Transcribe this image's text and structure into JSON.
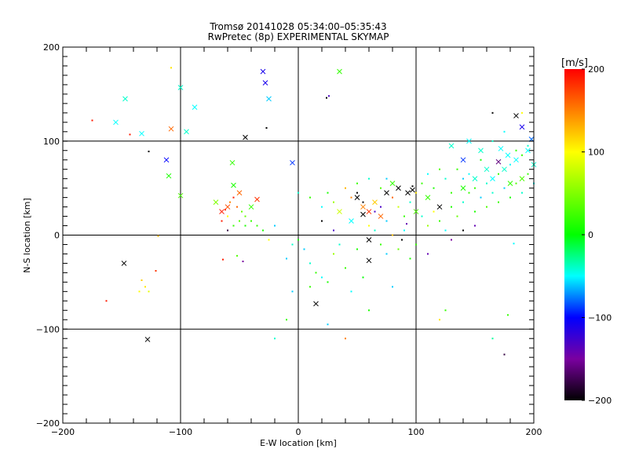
{
  "chart_data": {
    "type": "scatter",
    "title": "Tromsø 20141028 05:34:00–05:35:43",
    "subtitle": "RwPretec (8p) EXPERIMENTAL SKYMAP",
    "xlabel": "E-W location [km]",
    "ylabel": "N-S location [km]",
    "xlim": [
      -200,
      200
    ],
    "ylim": [
      -200,
      200
    ],
    "xticks": [
      -200,
      -100,
      0,
      100,
      200
    ],
    "yticks": [
      -200,
      -100,
      0,
      100,
      200
    ],
    "xtick_labels": [
      "−200",
      "−100",
      "0",
      "100",
      "200"
    ],
    "ytick_labels": [
      "−200",
      "−100",
      "0",
      "100",
      "200"
    ],
    "grid": true,
    "colorbar": {
      "label": "[m/s]",
      "range": [
        -200,
        200
      ],
      "ticks": [
        200,
        100,
        0,
        -100,
        -200
      ],
      "tick_labels": [
        "200",
        "100",
        "0",
        "−100",
        "−200"
      ],
      "colors": [
        "#000000",
        "#7a00a0",
        "#0000ff",
        "#00ffff",
        "#00ff00",
        "#ffff00",
        "#ff0000"
      ]
    },
    "crosses": [
      [
        -147,
        145,
        -40
      ],
      [
        -155,
        120,
        -50
      ],
      [
        -133,
        108,
        -50
      ],
      [
        -108,
        113,
        160
      ],
      [
        -112,
        80,
        -100
      ],
      [
        -110,
        63,
        10
      ],
      [
        -100,
        157,
        -40
      ],
      [
        -88,
        136,
        -50
      ],
      [
        -95,
        110,
        -40
      ],
      [
        -45,
        104,
        -200
      ],
      [
        -30,
        174,
        -110
      ],
      [
        -28,
        162,
        -110
      ],
      [
        -25,
        145,
        -60
      ],
      [
        -5,
        77,
        -90
      ],
      [
        35,
        174,
        20
      ],
      [
        -56,
        77,
        20
      ],
      [
        -55,
        53,
        10
      ],
      [
        -100,
        42,
        30
      ],
      [
        -148,
        -30,
        -200
      ],
      [
        -128,
        -111,
        -200
      ],
      [
        15,
        -73,
        -200
      ],
      [
        60,
        -27,
        -200
      ],
      [
        60,
        -5,
        -200
      ],
      [
        97,
        48,
        -200
      ],
      [
        93,
        45,
        -200
      ],
      [
        185,
        127,
        -200
      ],
      [
        190,
        115,
        -110
      ],
      [
        198,
        102,
        -80
      ],
      [
        172,
        92,
        -50
      ],
      [
        178,
        85,
        -50
      ],
      [
        160,
        70,
        -40
      ],
      [
        150,
        60,
        -40
      ],
      [
        140,
        80,
        -90
      ],
      [
        155,
        90,
        -40
      ],
      [
        170,
        78,
        -160
      ],
      [
        185,
        80,
        -50
      ],
      [
        190,
        60,
        30
      ],
      [
        130,
        95,
        -40
      ],
      [
        55,
        30,
        150
      ],
      [
        60,
        25,
        180
      ],
      [
        65,
        35,
        120
      ],
      [
        50,
        40,
        -200
      ],
      [
        70,
        20,
        160
      ],
      [
        75,
        45,
        -200
      ],
      [
        85,
        50,
        -200
      ],
      [
        55,
        22,
        -200
      ],
      [
        -60,
        30,
        170
      ],
      [
        -65,
        25,
        190
      ],
      [
        -50,
        45,
        160
      ],
      [
        -35,
        38,
        180
      ],
      [
        -40,
        30,
        20
      ],
      [
        -70,
        35,
        50
      ],
      [
        120,
        30,
        -200
      ],
      [
        80,
        55,
        20
      ],
      [
        45,
        15,
        -50
      ],
      [
        35,
        25,
        80
      ],
      [
        100,
        25,
        30
      ],
      [
        110,
        40,
        20
      ],
      [
        140,
        50,
        10
      ],
      [
        165,
        60,
        -50
      ],
      [
        175,
        70,
        -40
      ],
      [
        195,
        90,
        -50
      ],
      [
        180,
        55,
        20
      ],
      [
        145,
        100,
        -50
      ],
      [
        200,
        75,
        -40
      ]
    ],
    "dots": [
      [
        -175,
        122,
        190
      ],
      [
        -143,
        107,
        190
      ],
      [
        -108,
        178,
        110
      ],
      [
        -127,
        89,
        -200
      ],
      [
        -119,
        -1,
        130
      ],
      [
        -121,
        -38,
        180
      ],
      [
        -163,
        -70,
        190
      ],
      [
        -133,
        -48,
        120
      ],
      [
        -130,
        -55,
        110
      ],
      [
        -127,
        -60,
        90
      ],
      [
        -135,
        -60,
        100
      ],
      [
        -27,
        114,
        -200
      ],
      [
        26,
        148,
        -130
      ],
      [
        24,
        146,
        -200
      ],
      [
        -20,
        10,
        -60
      ],
      [
        -25,
        -5,
        100
      ],
      [
        -64,
        -26,
        190
      ],
      [
        -52,
        -22,
        30
      ],
      [
        -47,
        -28,
        -150
      ],
      [
        -45,
        20,
        40
      ],
      [
        -35,
        10,
        20
      ],
      [
        -30,
        5,
        10
      ],
      [
        -10,
        -25,
        -60
      ],
      [
        -5,
        -10,
        -40
      ],
      [
        0,
        -5,
        10
      ],
      [
        5,
        -15,
        -60
      ],
      [
        10,
        -30,
        -40
      ],
      [
        15,
        -40,
        20
      ],
      [
        20,
        -45,
        -50
      ],
      [
        25,
        -50,
        10
      ],
      [
        30,
        -20,
        60
      ],
      [
        35,
        -10,
        -40
      ],
      [
        40,
        -35,
        20
      ],
      [
        45,
        -60,
        -50
      ],
      [
        50,
        -15,
        10
      ],
      [
        55,
        -45,
        0
      ],
      [
        60,
        10,
        100
      ],
      [
        65,
        5,
        -40
      ],
      [
        70,
        -10,
        20
      ],
      [
        75,
        -20,
        -60
      ],
      [
        80,
        0,
        130
      ],
      [
        85,
        -15,
        40
      ],
      [
        90,
        5,
        -50
      ],
      [
        95,
        -25,
        10
      ],
      [
        100,
        -10,
        20
      ],
      [
        105,
        20,
        -40
      ],
      [
        110,
        10,
        60
      ],
      [
        115,
        25,
        100
      ],
      [
        120,
        15,
        20
      ],
      [
        125,
        5,
        -50
      ],
      [
        130,
        30,
        10
      ],
      [
        135,
        20,
        40
      ],
      [
        140,
        35,
        -40
      ],
      [
        145,
        45,
        20
      ],
      [
        150,
        25,
        10
      ],
      [
        155,
        40,
        -60
      ],
      [
        160,
        30,
        30
      ],
      [
        165,
        45,
        -40
      ],
      [
        170,
        35,
        20
      ],
      [
        175,
        50,
        -60
      ],
      [
        180,
        40,
        10
      ],
      [
        185,
        55,
        30
      ],
      [
        190,
        45,
        -40
      ],
      [
        195,
        65,
        20
      ],
      [
        200,
        55,
        -50
      ],
      [
        125,
        60,
        -40
      ],
      [
        135,
        70,
        20
      ],
      [
        145,
        65,
        -50
      ],
      [
        155,
        80,
        10
      ],
      [
        165,
        100,
        -40
      ],
      [
        175,
        110,
        -50
      ],
      [
        185,
        90,
        20
      ],
      [
        190,
        130,
        100
      ],
      [
        165,
        130,
        -200
      ],
      [
        183,
        -9,
        -50
      ],
      [
        178,
        -85,
        20
      ],
      [
        165,
        -110,
        -30
      ],
      [
        175,
        -127,
        -180
      ],
      [
        120,
        -90,
        110
      ],
      [
        125,
        -80,
        20
      ],
      [
        80,
        -55,
        -60
      ],
      [
        60,
        -80,
        10
      ],
      [
        40,
        -110,
        150
      ],
      [
        25,
        -95,
        -60
      ],
      [
        -10,
        -90,
        20
      ],
      [
        -20,
        -110,
        -40
      ],
      [
        -5,
        -60,
        -60
      ],
      [
        10,
        -55,
        20
      ],
      [
        0,
        45,
        -40
      ],
      [
        10,
        40,
        20
      ],
      [
        20,
        30,
        -50
      ],
      [
        25,
        45,
        10
      ],
      [
        30,
        35,
        60
      ],
      [
        40,
        50,
        130
      ],
      [
        45,
        40,
        150
      ],
      [
        50,
        55,
        20
      ],
      [
        60,
        60,
        -40
      ],
      [
        70,
        50,
        30
      ],
      [
        75,
        60,
        -60
      ],
      [
        80,
        40,
        160
      ],
      [
        85,
        30,
        80
      ],
      [
        90,
        20,
        20
      ],
      [
        95,
        35,
        -40
      ],
      [
        100,
        45,
        110
      ],
      [
        105,
        55,
        20
      ],
      [
        110,
        65,
        -50
      ],
      [
        115,
        50,
        10
      ],
      [
        120,
        70,
        30
      ],
      [
        130,
        45,
        20
      ],
      [
        140,
        60,
        -60
      ],
      [
        150,
        50,
        20
      ],
      [
        160,
        55,
        -40
      ],
      [
        170,
        65,
        20
      ],
      [
        180,
        75,
        -50
      ],
      [
        190,
        85,
        20
      ],
      [
        195,
        95,
        -40
      ],
      [
        -55,
        40,
        190
      ],
      [
        -60,
        20,
        100
      ],
      [
        -50,
        15,
        30
      ],
      [
        -45,
        10,
        10
      ],
      [
        -40,
        15,
        20
      ],
      [
        -62,
        27,
        180
      ],
      [
        -58,
        35,
        150
      ],
      [
        -52,
        30,
        160
      ],
      [
        -48,
        25,
        40
      ],
      [
        -65,
        15,
        190
      ],
      [
        -55,
        10,
        20
      ],
      [
        -60,
        5,
        -180
      ],
      [
        65,
        25,
        -130
      ],
      [
        70,
        30,
        -130
      ],
      [
        55,
        35,
        -200
      ],
      [
        50,
        45,
        -200
      ],
      [
        97,
        52,
        -200
      ],
      [
        75,
        15,
        -60
      ],
      [
        88,
        -5,
        -200
      ],
      [
        92,
        12,
        -140
      ],
      [
        110,
        -20,
        -140
      ],
      [
        150,
        10,
        -140
      ],
      [
        140,
        5,
        -200
      ],
      [
        130,
        -5,
        -150
      ],
      [
        20,
        15,
        -200
      ],
      [
        30,
        5,
        -130
      ]
    ]
  }
}
